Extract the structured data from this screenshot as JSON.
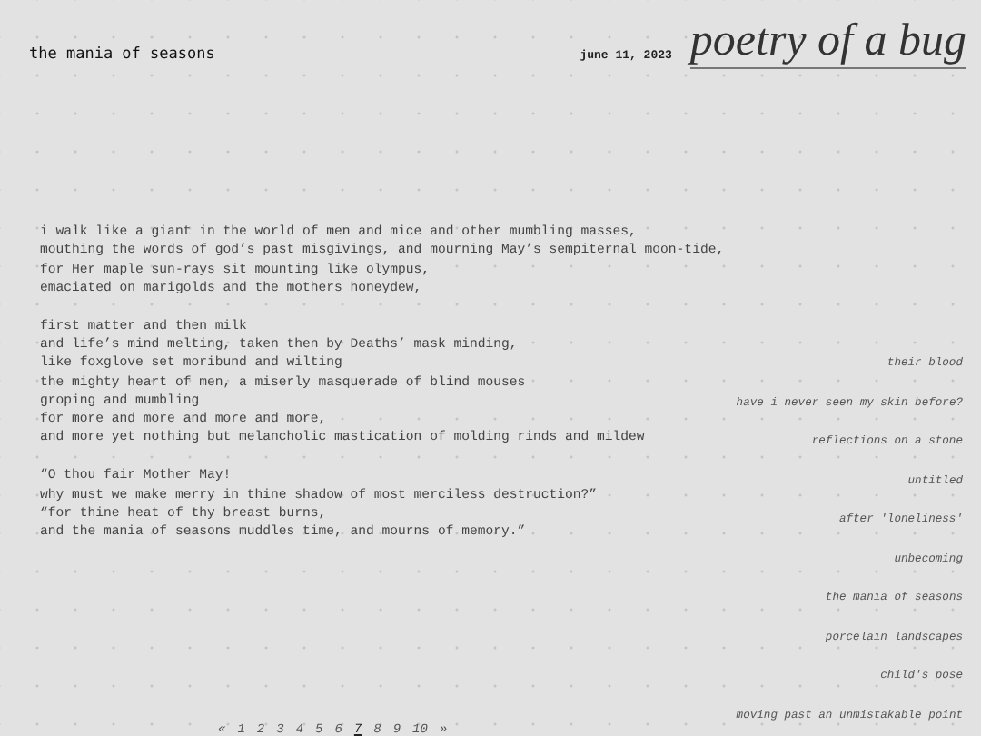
{
  "header": {
    "post_title": "the mania of seasons",
    "date": "june 11, 2023",
    "blog_title": "poetry of a bug"
  },
  "poem": {
    "stanzas": [
      [
        "i walk like a giant in the world of men and mice and other mumbling masses,",
        "mouthing the words of god’s past misgivings, and mourning May’s sempiternal moon-tide,",
        "for Her maple sun-rays sit mounting like olympus,",
        "emaciated on marigolds and the mothers honeydew,"
      ],
      [
        "first matter and then milk",
        "and life’s mind melting, taken then by Deaths’ mask minding,",
        "like foxglove set moribund and wilting",
        "the mighty heart of men, a miserly masquerade of blind mouses",
        "groping and mumbling",
        "for more and more and more and more,",
        "and more yet nothing but melancholic mastication of molding rinds and mildew"
      ],
      [
        "“O thou fair Mother May!",
        "why must we make merry in thine shadow of most merciless destruction?”",
        "“for thine heat of thy breast burns,",
        "and the mania of seasons muddles time, and mourns of memory.”"
      ]
    ]
  },
  "sidebar": {
    "items": [
      "their blood",
      "have i never seen my skin before?",
      "reflections on a stone",
      "untitled",
      "after 'loneliness'",
      "unbecoming",
      "the mania of seasons",
      "porcelain landscapes",
      "child's pose",
      "moving past an unmistakable point"
    ]
  },
  "pagination": {
    "prev": "«",
    "next": "»",
    "pages": [
      {
        "label": "1",
        "selected": false
      },
      {
        "label": "2",
        "selected": false
      },
      {
        "label": "3",
        "selected": false
      },
      {
        "label": "4",
        "selected": false
      },
      {
        "label": "5",
        "selected": false
      },
      {
        "label": "6",
        "selected": false
      },
      {
        "label": "7",
        "selected": true
      },
      {
        "label": "8",
        "selected": false
      },
      {
        "label": "9",
        "selected": false
      },
      {
        "label": "10",
        "selected": false
      }
    ]
  }
}
